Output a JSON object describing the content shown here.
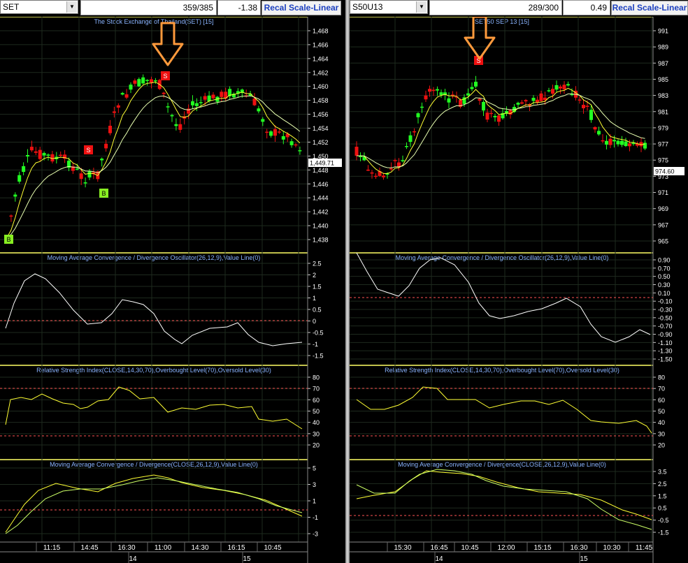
{
  "left": {
    "symbol": "SET",
    "count": "359/385",
    "change": "-1.38",
    "recal_label": "Recal Scale-Linear",
    "price_panel": {
      "title": "The Stock Exchange of Thailand(SET)  [15]",
      "ticks": [
        "1,468",
        "1,466",
        "1,464",
        "1,462",
        "1,460",
        "1,458",
        "1,456",
        "1,454",
        "1,452",
        "1,450",
        "1,448",
        "1,446",
        "1,444",
        "1,442",
        "1,440",
        "1,438"
      ],
      "last_price": "1,449.71",
      "signals": [
        {
          "label": "S",
          "kind": "sell"
        },
        {
          "label": "S",
          "kind": "sell"
        },
        {
          "label": "B",
          "kind": "buy"
        },
        {
          "label": "B",
          "kind": "buy"
        }
      ]
    },
    "macd_panel": {
      "title": "Moving Average Convergence / Divergence Oscillator(26,12,9),Value Line(0)",
      "ticks": [
        "2.5",
        "2",
        "1.5",
        "1",
        "0.5",
        "0",
        "-0.5",
        "-1",
        "-1.5"
      ]
    },
    "rsi_panel": {
      "title": "Relative Strength Index(CLOSE,14,30,70),Overbought Level(70),Oversold Level(30)",
      "ticks": [
        "80",
        "70",
        "60",
        "50",
        "40",
        "30",
        "20"
      ]
    },
    "macd2_panel": {
      "title": "Moving Average Convergence / Divergence(CLOSE,26,12,9),Value Line(0)",
      "ticks": [
        "5",
        "3",
        "1",
        "-1",
        "-3"
      ]
    },
    "time_labels": [
      "11:15",
      "14:45",
      "16:30",
      "11:00",
      "14:30",
      "16:15",
      "10:45"
    ],
    "date_labels": [
      "14",
      "15"
    ]
  },
  "right": {
    "symbol": "S50U13",
    "count": "289/300",
    "change": "0.49",
    "recal_label": "Recal Scale-Linear",
    "price_panel": {
      "title": "SET50 SEP 13  [15]",
      "ticks": [
        "991",
        "989",
        "987",
        "985",
        "983",
        "981",
        "979",
        "977",
        "975",
        "973",
        "971",
        "969",
        "967",
        "965"
      ],
      "last_price": "974.60",
      "signals": [
        {
          "label": "S",
          "kind": "sell"
        }
      ]
    },
    "macd_panel": {
      "title": "Moving Average Convergence / Divergence Oscillator(26,12,9),Value Line(0)",
      "ticks": [
        "0.90",
        "0.70",
        "0.50",
        "0.30",
        "0.10",
        "-0.10",
        "-0.30",
        "-0.50",
        "-0.70",
        "-0.90",
        "-1.10",
        "-1.30",
        "-1.50"
      ]
    },
    "rsi_panel": {
      "title": "Relative Strength Index(CLOSE,14,30,70),Overbought Level(70),Oversold Level(30)",
      "ticks": [
        "80",
        "70",
        "60",
        "50",
        "40",
        "30",
        "20"
      ]
    },
    "macd2_panel": {
      "title": "Moving Average Convergence / Divergence(CLOSE,26,12,9),Value Line(0)",
      "ticks": [
        "3.5",
        "2.5",
        "1.5",
        "0.5",
        "-0.5",
        "-1.5"
      ]
    },
    "time_labels": [
      "15:30",
      "16:45",
      "10:45",
      "12:00",
      "15:15",
      "16:30",
      "10:30",
      "11:45"
    ],
    "date_labels": [
      "14",
      "15"
    ]
  },
  "colors": {
    "panel_border": "#ffff66",
    "grid": "#1e2a1e",
    "up": "#22ff22",
    "down": "#ee1111",
    "ma_fast": "#ffff33",
    "ma_slow": "#e8ffb0",
    "macd_line": "#ffffff",
    "signal_line": "#ccff66",
    "level_line": "#ff5555",
    "title_text": "#8ab4ff",
    "arrow": "#ff9a3c"
  },
  "icons": [
    "dropdown-arrow-icon",
    "down-arrow-annotation-icon"
  ]
}
